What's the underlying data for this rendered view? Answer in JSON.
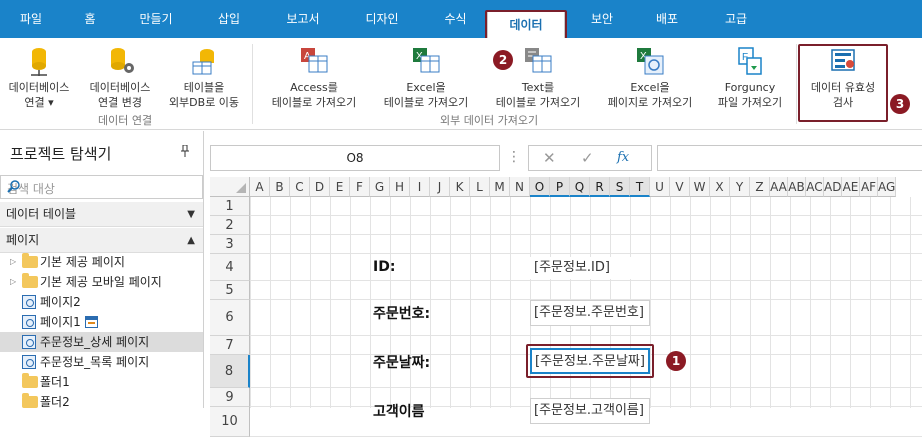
{
  "ribbon": {
    "tabs": [
      "파일",
      "홈",
      "만들기",
      "삽입",
      "보고서",
      "디자인",
      "수식",
      "데이터",
      "보안",
      "배포",
      "고급"
    ],
    "active_tab": "데이터",
    "buttons": {
      "db_connect_1": "데이터베이스",
      "db_connect_2": "연결 ▾",
      "db_change_1": "데이터베이스",
      "db_change_2": "연결 변경",
      "move_table_1": "테이블을",
      "move_table_2": "외부DB로 이동",
      "access_1": "Access를",
      "access_2": "테이블로 가져오기",
      "excel_1": "Excel을",
      "excel_2": "테이블로 가져오기",
      "text_1": "Text를",
      "text_2": "테이블로 가져오기",
      "excel_page_1": "Excel을",
      "excel_page_2": "페이지로 가져오기",
      "forguncy_1": "Forguncy",
      "forguncy_2": "파일 가져오기",
      "validation_1": "데이터 유효성",
      "validation_2": "검사"
    },
    "groups": {
      "data_connection": "데이터 연결",
      "external_import": "외부 데이터 가져오기"
    }
  },
  "badges": [
    "1",
    "2",
    "3"
  ],
  "explorer": {
    "title": "프로젝트 탐색기",
    "pin_icon": "pin-icon",
    "search_placeholder": "검색 대상",
    "section_tables": "데이터 테이블",
    "section_pages": "페이지",
    "items": [
      {
        "label": "기본 제공 페이지",
        "type": "folder",
        "expand": true
      },
      {
        "label": "기본 제공 모바일 페이지",
        "type": "folder",
        "expand": true
      },
      {
        "label": "페이지2",
        "type": "page"
      },
      {
        "label": "페이지1",
        "type": "page",
        "extra": true
      },
      {
        "label": "주문정보_상세 페이지",
        "type": "page",
        "selected": true
      },
      {
        "label": "주문정보_목록 페이지",
        "type": "page"
      },
      {
        "label": "폴더1",
        "type": "folder"
      },
      {
        "label": "폴더2",
        "type": "folder"
      }
    ]
  },
  "formula": {
    "cell_ref": "O8",
    "fx": "fx",
    "cancel": "✕",
    "confirm": "✓"
  },
  "grid": {
    "columns": [
      "A",
      "B",
      "C",
      "D",
      "E",
      "F",
      "G",
      "H",
      "I",
      "J",
      "K",
      "L",
      "M",
      "N",
      "O",
      "P",
      "Q",
      "R",
      "S",
      "T",
      "U",
      "V",
      "W",
      "X",
      "Y",
      "Z",
      "AA",
      "AB",
      "AC",
      "AD",
      "AE",
      "AF",
      "AG"
    ],
    "selected_cols": [
      "O",
      "P",
      "Q",
      "R",
      "S",
      "T"
    ],
    "rows": [
      "1",
      "2",
      "3",
      "4",
      "5",
      "6",
      "7",
      "8",
      "9",
      "10"
    ],
    "selected_row": "8",
    "labels": {
      "id": "ID:",
      "order_no": "주문번호:",
      "order_date": "주문날짜:",
      "partial": "고객이름"
    },
    "fields": {
      "id": "[주문정보.ID]",
      "order_no": "[주문정보.주문번호]",
      "order_date": "[주문정보.주문날짜]",
      "partial": "[주문정보.고객이름]"
    }
  }
}
